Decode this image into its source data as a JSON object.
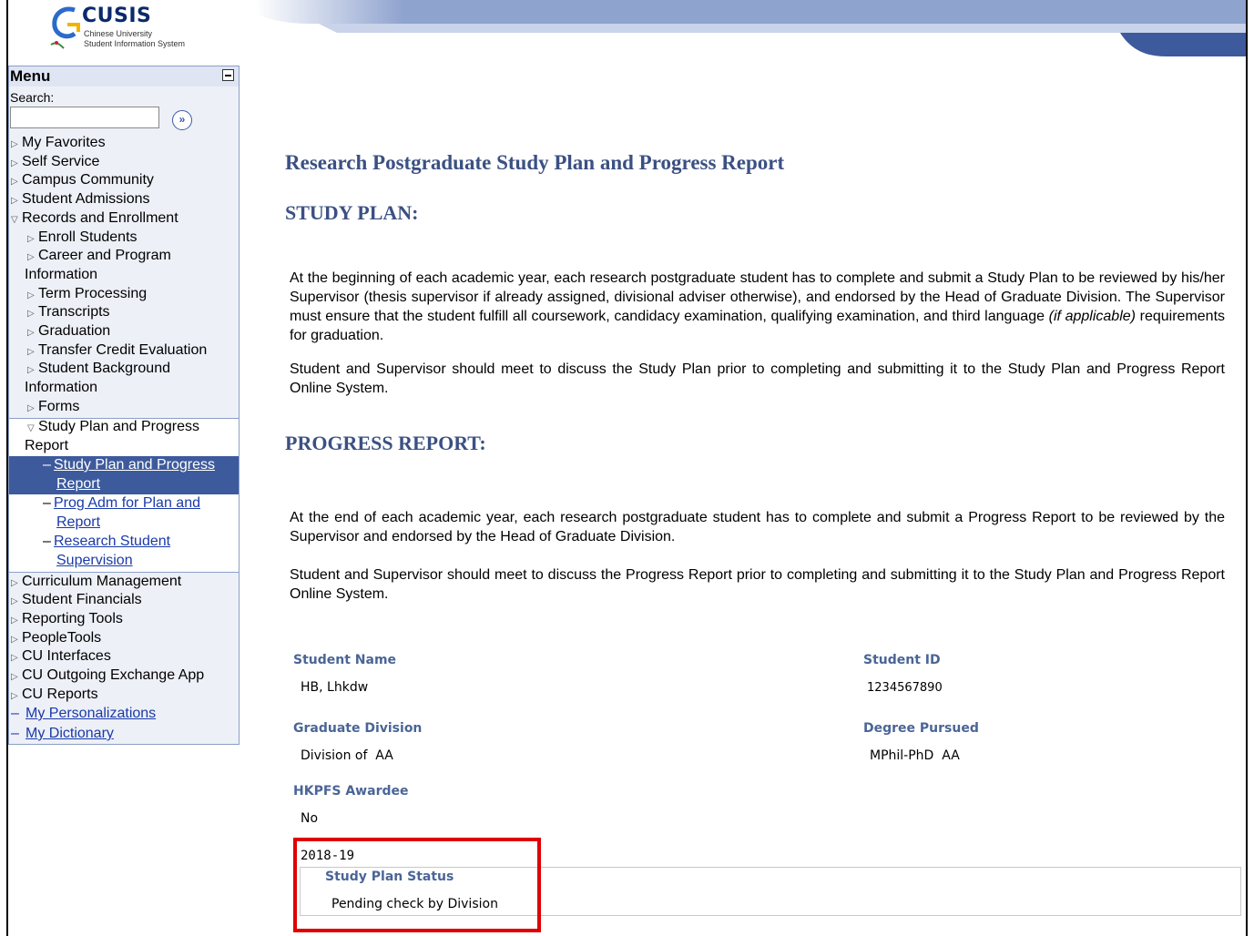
{
  "header": {
    "logo_title": "CUSIS",
    "logo_line1": "Chinese University",
    "logo_line2": "Student Information System"
  },
  "menu": {
    "title": "Menu",
    "search_label": "Search:",
    "items": [
      {
        "label": "My Favorites",
        "type": "collapsed"
      },
      {
        "label": "Self Service",
        "type": "collapsed"
      },
      {
        "label": "Campus Community",
        "type": "collapsed"
      },
      {
        "label": "Student Admissions",
        "type": "collapsed"
      },
      {
        "label": "Records and Enrollment",
        "type": "expanded"
      },
      {
        "label": "Enroll Students",
        "type": "collapsed"
      },
      {
        "label": "Career and Program",
        "type": "collapsed"
      },
      {
        "label": "Information",
        "type": "wrap"
      },
      {
        "label": "Term Processing",
        "type": "collapsed"
      },
      {
        "label": "Transcripts",
        "type": "collapsed"
      },
      {
        "label": "Graduation",
        "type": "collapsed"
      },
      {
        "label": "Transfer Credit Evaluation",
        "type": "collapsed"
      },
      {
        "label": "Student Background",
        "type": "collapsed"
      },
      {
        "label": "Information",
        "type": "wrap"
      },
      {
        "label": "Forms",
        "type": "collapsed"
      },
      {
        "label": "Study Plan and Progress",
        "type": "expanded"
      },
      {
        "label": "Report",
        "type": "wrap"
      },
      {
        "label": "Study Plan and Progress",
        "type": "selected"
      },
      {
        "label": "Report",
        "type": "selected"
      },
      {
        "label": "Prog Adm for Plan and",
        "type": "link"
      },
      {
        "label": "Report",
        "type": "link"
      },
      {
        "label": "Research Student",
        "type": "link"
      },
      {
        "label": "Supervision",
        "type": "link"
      },
      {
        "label": "Curriculum Management",
        "type": "collapsed"
      },
      {
        "label": "Student Financials",
        "type": "collapsed"
      },
      {
        "label": "Reporting Tools",
        "type": "collapsed"
      },
      {
        "label": "PeopleTools",
        "type": "collapsed"
      },
      {
        "label": "CU Interfaces",
        "type": "collapsed"
      },
      {
        "label": "CU Outgoing Exchange App",
        "type": "collapsed"
      },
      {
        "label": "CU Reports",
        "type": "collapsed"
      },
      {
        "label": "My Personalizations",
        "type": "link"
      },
      {
        "label": "My Dictionary",
        "type": "link"
      }
    ]
  },
  "main": {
    "title": "Research Postgraduate Study Plan and Progress Report",
    "study_plan_heading": "STUDY PLAN:",
    "study_plan_p1_a": "At the beginning of each academic year, each research postgraduate student has to complete and submit a Study Plan to be reviewed by his/her Supervisor (thesis supervisor if already assigned, divisional adviser otherwise), and endorsed by the Head of Graduate Division. The Supervisor must ensure that the student fulfill all coursework, candidacy examination, qualifying examination, and third language ",
    "study_plan_p1_italic": "(if applicable)",
    "study_plan_p1_b": " requirements for graduation.",
    "study_plan_p2": "Student and Supervisor should meet to discuss the Study Plan prior to completing and submitting it to the Study Plan and Progress Report Online System.",
    "progress_heading": "PROGRESS REPORT:",
    "progress_p1": "At the end of each academic year, each research postgraduate student has to complete and submit a Progress Report to be reviewed by the Supervisor and endorsed by the Head of Graduate Division.",
    "progress_p2": "Student and Supervisor should meet to discuss the Progress Report prior to completing and submitting it to the Study Plan and Progress Report Online System."
  },
  "student": {
    "name_label": "Student Name",
    "name_value": "HB, Lhkdw",
    "id_label": "Student ID",
    "id_value": "1234567890",
    "division_label": "Graduate Division",
    "division_value": "Division of  AA",
    "degree_label": "Degree Pursued",
    "degree_value": "MPhil-PhD  AA",
    "hkpfs_label": "HKPFS Awardee",
    "hkpfs_value": "No"
  },
  "status": {
    "year": "2018-19",
    "label": "Study Plan Status",
    "value": "Pending check by Division"
  },
  "colors": {
    "heading": "#3b5083",
    "field_label": "#4a6596",
    "link": "#1a3aa8",
    "menu_selected_bg": "#3d5a9c",
    "highlight": "#e00000"
  }
}
